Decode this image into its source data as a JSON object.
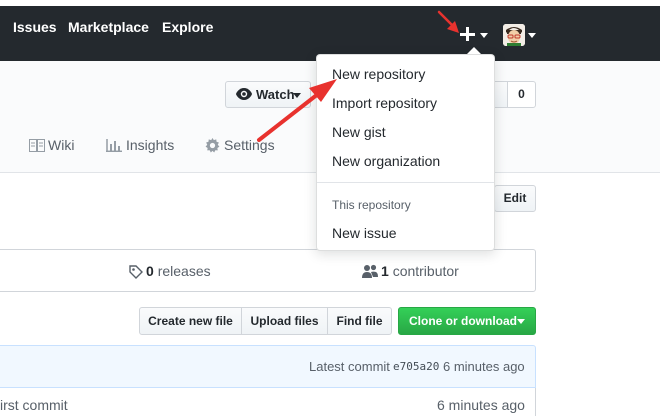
{
  "header": {
    "nav": [
      {
        "label": "Issues"
      },
      {
        "label": "Marketplace"
      },
      {
        "label": "Explore"
      }
    ]
  },
  "repo": {
    "watch_label": "Watch",
    "star_count": "0",
    "tabs": [
      {
        "label": "Wiki",
        "icon": "book-icon"
      },
      {
        "label": "Insights",
        "icon": "graph-icon"
      },
      {
        "label": "Settings",
        "icon": "gear-icon"
      }
    ],
    "edit_label": "Edit"
  },
  "stats": {
    "releases_count": "0",
    "releases_label": "releases",
    "contributors_count": "1",
    "contributors_label": "contributor"
  },
  "file_actions": {
    "create_new_file": "Create new file",
    "upload_files": "Upload files",
    "find_file": "Find file",
    "clone_or_download": "Clone or download"
  },
  "commit": {
    "latest_label": "Latest commit",
    "sha": "e705a20",
    "time": "6 minutes ago",
    "row_message": "irst commit",
    "row_time": "6 minutes ago"
  },
  "dropdown": {
    "items": [
      {
        "label": "New repository"
      },
      {
        "label": "Import repository"
      },
      {
        "label": "New gist"
      },
      {
        "label": "New organization"
      }
    ],
    "section_header": "This repository",
    "section_items": [
      {
        "label": "New issue"
      }
    ]
  },
  "colors": {
    "header_bg": "#24292e",
    "clone_green": "#28a745",
    "annotation_red": "#e8322e"
  }
}
